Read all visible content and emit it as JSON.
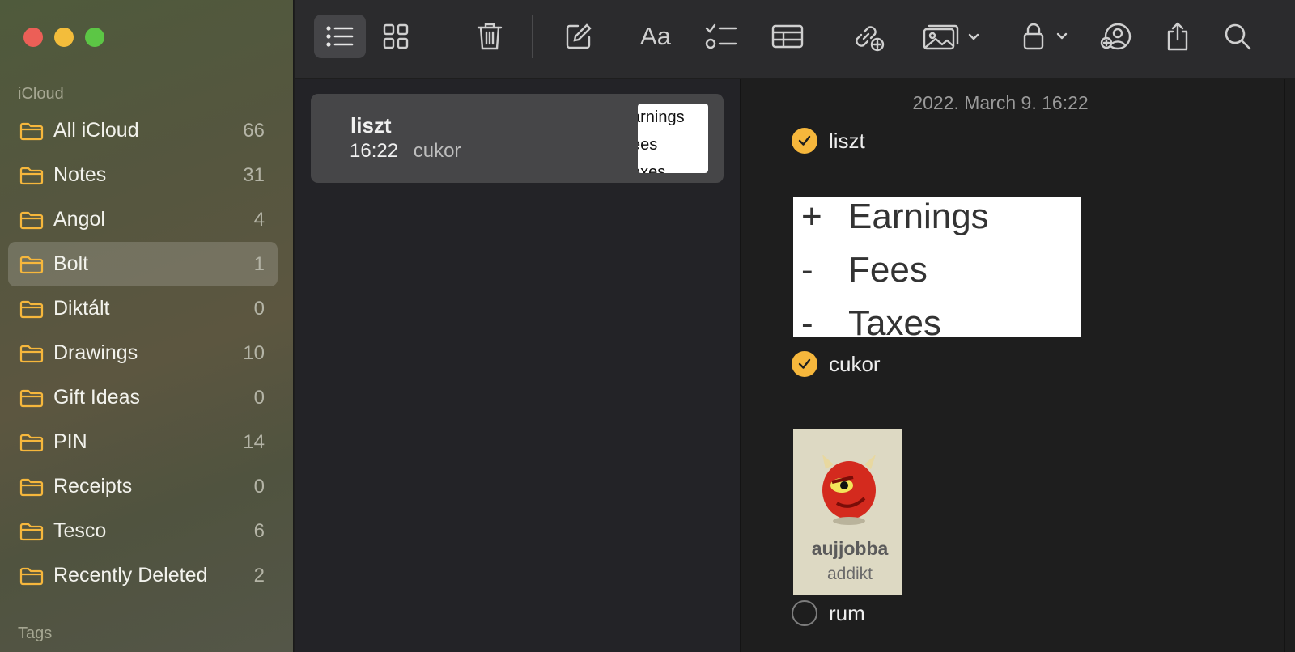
{
  "sidebar": {
    "icloud_label": "iCloud",
    "tags_label": "Tags",
    "folders": [
      {
        "name": "All iCloud",
        "count": "66"
      },
      {
        "name": "Notes",
        "count": "31"
      },
      {
        "name": "Angol",
        "count": "4"
      },
      {
        "name": "Bolt",
        "count": "1",
        "selected": true
      },
      {
        "name": "Diktált",
        "count": "0"
      },
      {
        "name": "Drawings",
        "count": "10"
      },
      {
        "name": "Gift Ideas",
        "count": "0"
      },
      {
        "name": "PIN",
        "count": "14"
      },
      {
        "name": "Receipts",
        "count": "0"
      },
      {
        "name": "Tesco",
        "count": "6"
      },
      {
        "name": "Recently Deleted",
        "count": "2"
      }
    ],
    "folder_icon": "folder-icon",
    "accent_color": "#f6b73c"
  },
  "toolbar": {
    "format_label": "Aa",
    "icons": [
      "list-view-icon",
      "gallery-view-icon",
      "trash-icon",
      "compose-icon",
      "format-icon",
      "checklist-icon",
      "table-icon",
      "link-note-icon",
      "media-icon",
      "lock-icon",
      "collaborate-icon",
      "share-icon",
      "search-icon"
    ]
  },
  "notelist": {
    "note": {
      "title": "liszt",
      "time": "16:22",
      "preview": "cukor",
      "thumb_lines": [
        "arnings",
        "ees",
        "axes"
      ]
    }
  },
  "editor": {
    "date": "2022. March 9. 16:22",
    "items": [
      {
        "text": "liszt",
        "checked": true
      },
      {
        "text": "cukor",
        "checked": true
      },
      {
        "text": "rum",
        "checked": false
      }
    ],
    "image1": {
      "rows": [
        {
          "sym": "+",
          "text": "Earnings"
        },
        {
          "sym": "-",
          "text": "Fees"
        },
        {
          "sym": "-",
          "text": "Taxes"
        }
      ]
    },
    "image2": {
      "line1": "aujjobba",
      "line2": "addikt"
    }
  }
}
